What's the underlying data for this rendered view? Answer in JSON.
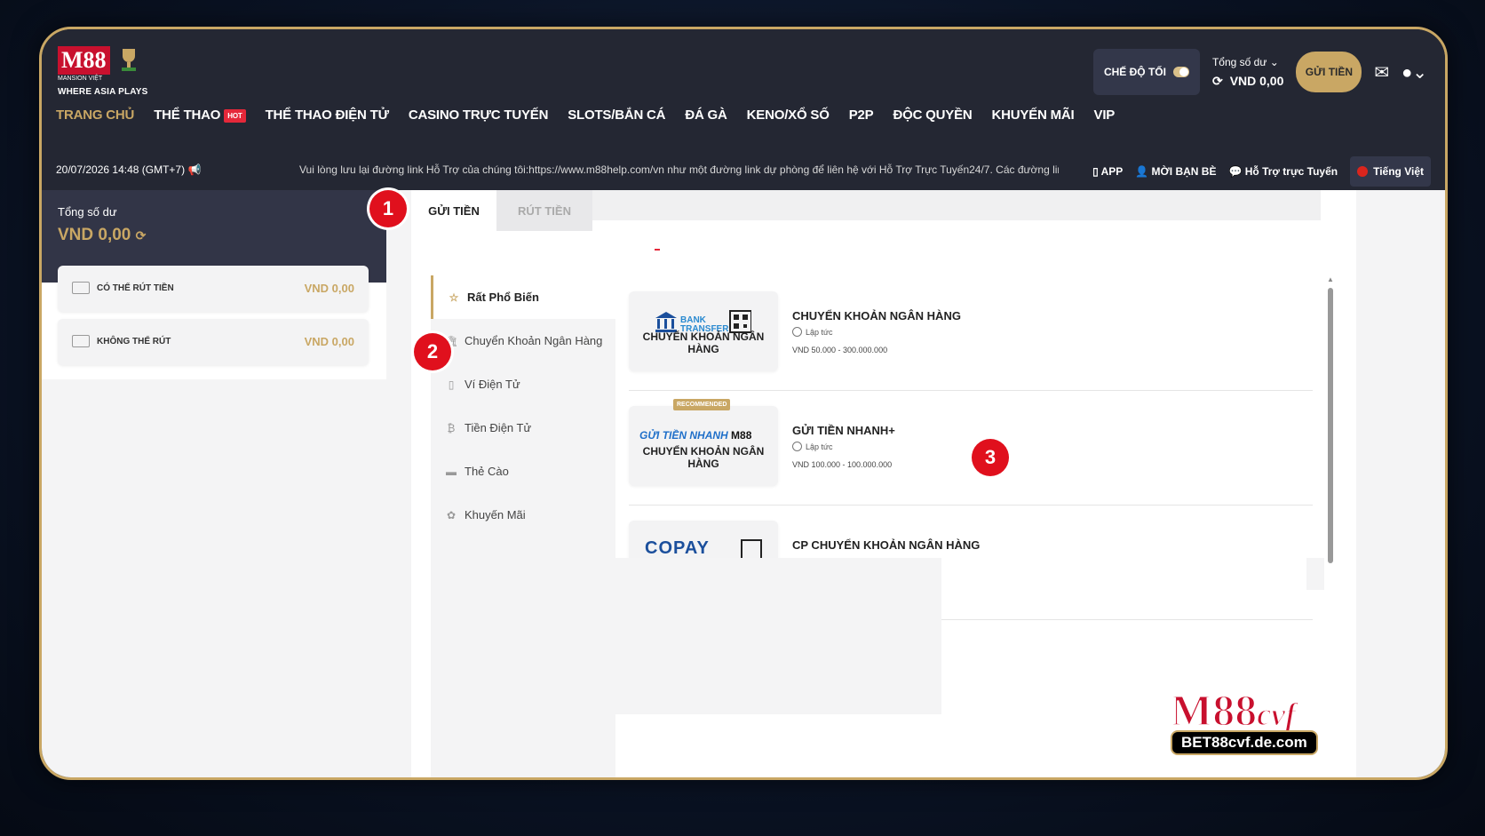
{
  "header": {
    "logo": {
      "brand": "M88",
      "sub": "MANSION VIỆT",
      "tagline": "WHERE ASIA PLAYS"
    },
    "dark_mode_label": "CHẾ ĐỘ TỐI",
    "balance_label": "Tổng số dư",
    "balance_value": "VND 0,00",
    "deposit_button": "GỬI TIỀN",
    "nav": [
      {
        "label": "TRANG CHỦ"
      },
      {
        "label": "THỂ THAO",
        "badge": "HOT"
      },
      {
        "label": "THỂ THAO ĐIỆN TỬ"
      },
      {
        "label": "CASINO TRỰC TUYẾN"
      },
      {
        "label": "SLOTS/BẮN CÁ"
      },
      {
        "label": "ĐÁ GÀ"
      },
      {
        "label": "KENO/XỔ SỐ"
      },
      {
        "label": "P2P"
      },
      {
        "label": "ĐỘC QUYỀN"
      },
      {
        "label": "KHUYẾN MÃI"
      },
      {
        "label": "VIP"
      }
    ]
  },
  "ticker": {
    "datetime": "20/07/2026 14:48 (GMT+7)",
    "message": "Vui lòng lưu lại đường link Hỗ Trợ của chúng tôi:https://www.m88help.com/vn như một đường link dự phòng để liên hệ với Hỗ Trợ Trực Tuyến24/7. Các đường link mới nhất của chúng tôi cũng có thể được lấy",
    "app": "APP",
    "invite": "MỜI BẠN BÈ",
    "support": "Hỗ Trợ trực Tuyến",
    "language": "Tiếng Việt"
  },
  "wallet": {
    "total_label": "Tổng số dư",
    "total_value": "VND 0,00",
    "withdrawable_label": "CÓ THỂ RÚT TIỀN",
    "withdrawable_value": "VND 0,00",
    "non_withdrawable_label": "KHÔNG THỂ RÚT",
    "non_withdrawable_value": "VND 0,00"
  },
  "tabs": {
    "deposit": "GỬI TIỀN",
    "withdraw": "RÚT TIỀN"
  },
  "categories": [
    {
      "label": "Rất Phổ Biến",
      "icon": "star-icon"
    },
    {
      "label": "Chuyển Khoản Ngân Hàng",
      "icon": "bank-icon"
    },
    {
      "label": "Ví Điện Tử",
      "icon": "wallet-icon"
    },
    {
      "label": "Tiền Điện Tử",
      "icon": "bitcoin-icon"
    },
    {
      "label": "Thẻ Cào",
      "icon": "card-icon"
    },
    {
      "label": "Khuyến Mãi",
      "icon": "gift-icon"
    }
  ],
  "methods": [
    {
      "logo_text": "BANK TRANSFER",
      "caption": "CHUYỂN KHOẢN NGÂN HÀNG",
      "title": "CHUYỂN KHOẢN NGÂN HÀNG",
      "speed": "Lập tức",
      "range": "VND 50.000 - 300.000.000"
    },
    {
      "badge": "RECOMMENDED",
      "logo_text": "GỬI TIỀN NHANH",
      "logo_brand": "M88",
      "caption": "CHUYỂN KHOẢN NGÂN HÀNG",
      "title": "GỬI TIỀN NHANH+",
      "speed": "Lập tức",
      "range": "VND 100.000 - 100.000.000"
    },
    {
      "logo_text": "COPAY",
      "title": "CP CHUYỂN KHOẢN NGÂN HÀNG"
    }
  ],
  "step_badges": [
    "1",
    "2",
    "3"
  ],
  "watermark": {
    "brand": "M88",
    "suffix": "cvf",
    "url": "BET88cvf.de.com"
  },
  "colors": {
    "accent": "#c9a764",
    "header_bg": "#242733",
    "badge_red": "#e0101d"
  }
}
